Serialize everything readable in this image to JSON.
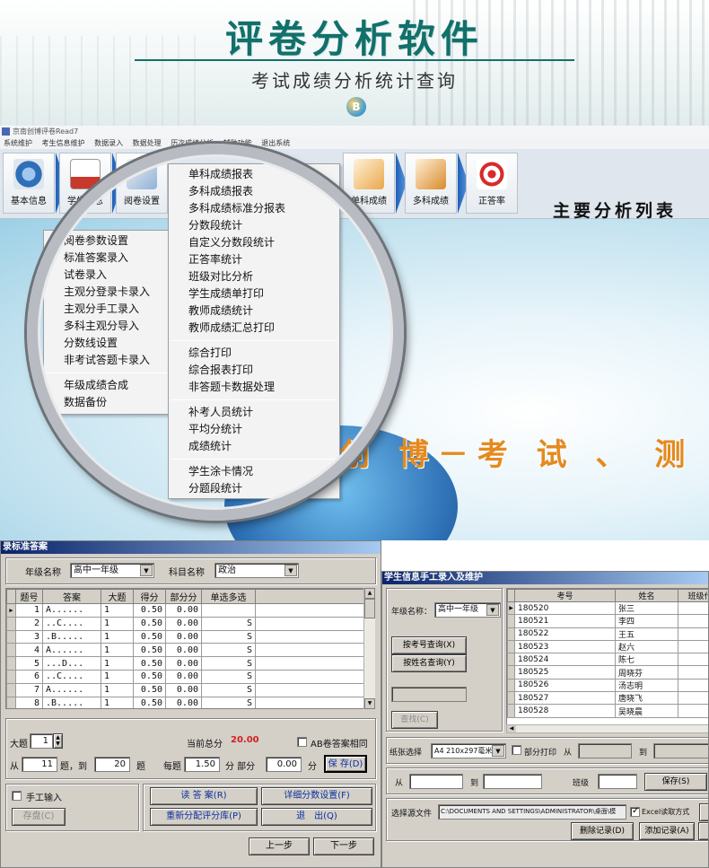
{
  "banner": {
    "title": "评卷分析软件",
    "subtitle": "考试成绩分析统计查询",
    "logo_letter": "B"
  },
  "app": {
    "window_title": "京南创博评卷Read7",
    "menubar": [
      "系统维护",
      "考生信息维护",
      "数据录入",
      "数据处理",
      "历次成绩分析",
      "辅助功能",
      "退出系统"
    ],
    "toolbar": [
      {
        "label": "基本信息",
        "icon": "gear-icon"
      },
      {
        "label": "学生信息",
        "icon": "contact-card-icon"
      },
      {
        "label": "阅卷设置",
        "icon": "settings-sheet-icon"
      },
      {
        "label": "单科成绩",
        "icon": "single-score-icon"
      },
      {
        "label": "多科成绩",
        "icon": "multi-score-icon"
      },
      {
        "label": "正答率",
        "icon": "target-icon"
      }
    ],
    "panel_title": "主要分析列表",
    "slogan": "创 博－考 试 、 测 试",
    "menu_left": {
      "group1": [
        "阅卷参数设置",
        "标准答案录入",
        "试卷录入",
        "主观分登录卡录入",
        "主观分手工录入",
        "多科主观分导入",
        "分数线设置",
        "非考试答题卡录入"
      ],
      "group2": [
        "年级成绩合成",
        "数据备份"
      ]
    },
    "menu_right": {
      "group1": [
        "单科成绩报表",
        "多科成绩报表",
        "多科成绩标准分报表",
        "分数段统计",
        "自定义分数段统计",
        "正答率统计",
        "班级对比分析",
        "学生成绩单打印",
        "教师成绩统计",
        "教师成绩汇总打印"
      ],
      "group2": [
        "综合打印",
        "综合报表打印",
        "非答题卡数据处理"
      ],
      "group3": [
        "补考人员统计",
        "平均分统计",
        "成绩统计"
      ],
      "group4": [
        "学生涂卡情况",
        "分题段统计"
      ]
    }
  },
  "answer_dialog": {
    "title": "录标准答案",
    "grade_label": "年级名称",
    "grade_value": "高中一年级",
    "subject_label": "科目名称",
    "subject_value": "政治",
    "columns": [
      "题号",
      "答案",
      "大题",
      "得分",
      "部分分",
      "单选多选"
    ],
    "rows": [
      [
        "1",
        "A......",
        "1",
        "0.50",
        "0.00",
        ""
      ],
      [
        "2",
        "..C....",
        "1",
        "0.50",
        "0.00",
        "S"
      ],
      [
        "3",
        ".B.....",
        "1",
        "0.50",
        "0.00",
        "S"
      ],
      [
        "4",
        "A......",
        "1",
        "0.50",
        "0.00",
        "S"
      ],
      [
        "5",
        "...D...",
        "1",
        "0.50",
        "0.00",
        "S"
      ],
      [
        "6",
        "..C....",
        "1",
        "0.50",
        "0.00",
        "S"
      ],
      [
        "7",
        "A......",
        "1",
        "0.50",
        "0.00",
        "S"
      ],
      [
        "8",
        ".B.....",
        "1",
        "0.50",
        "0.00",
        "S"
      ]
    ],
    "big_label": "大题",
    "big_value": "1",
    "total_label": "当前总分",
    "total_value": "20.00",
    "ab_label": "AB卷答案相同",
    "from_label": "从",
    "from_value": "11",
    "to_label": "题，到",
    "to_value": "20",
    "each_label": "题　　每题",
    "each_value": "1.50",
    "partial_label": "分 部分",
    "partial_value": "0.00",
    "score_unit": "分",
    "save_label": "保 存(D)",
    "manual_label": "手工输入",
    "store_label": "存盘(C)",
    "read_answer_label": "读 答 案(R)",
    "detail_label": "详细分数设置(F)",
    "redistribute_label": "重新分配评分库(P)",
    "exit_label": "退　出(Q)",
    "prev_label": "上一步",
    "next_label": "下一步"
  },
  "student_dialog": {
    "title": "学生信息手工录入及维护",
    "grade_label": "年级名称：",
    "grade_value": "高中一年级",
    "by_id_label": "按考号查询(X)",
    "by_name_label": "按姓名查询(Y)",
    "find_label": "查找(C)",
    "columns": [
      "考号",
      "姓名",
      "班级代"
    ],
    "rows": [
      [
        "180520",
        "张三"
      ],
      [
        "180521",
        "李四"
      ],
      [
        "180522",
        "王五"
      ],
      [
        "180523",
        "赵六"
      ],
      [
        "180524",
        "陈七"
      ],
      [
        "180525",
        "周晓芬"
      ],
      [
        "180526",
        "汤志明"
      ],
      [
        "180527",
        "唐晓飞"
      ],
      [
        "180528",
        "吴晓晨"
      ]
    ],
    "paper_label": "纸张选择",
    "paper_value": "A4 210x297毫米",
    "partial_print_label": "部分打印",
    "from_label": "从",
    "to_label": "到",
    "from_label2": "从",
    "to_label2": "到",
    "class_label": "班级",
    "save_label": "保存(S)",
    "source_label": "选择源文件",
    "source_value": "C:\\DOCUMENTS AND SETTINGS\\ADMINISTRATOR\\桌面\\模",
    "excel_label": "Excel读取方式",
    "delete_label": "删除记录(D)",
    "add_label": "添加记录(A)"
  }
}
